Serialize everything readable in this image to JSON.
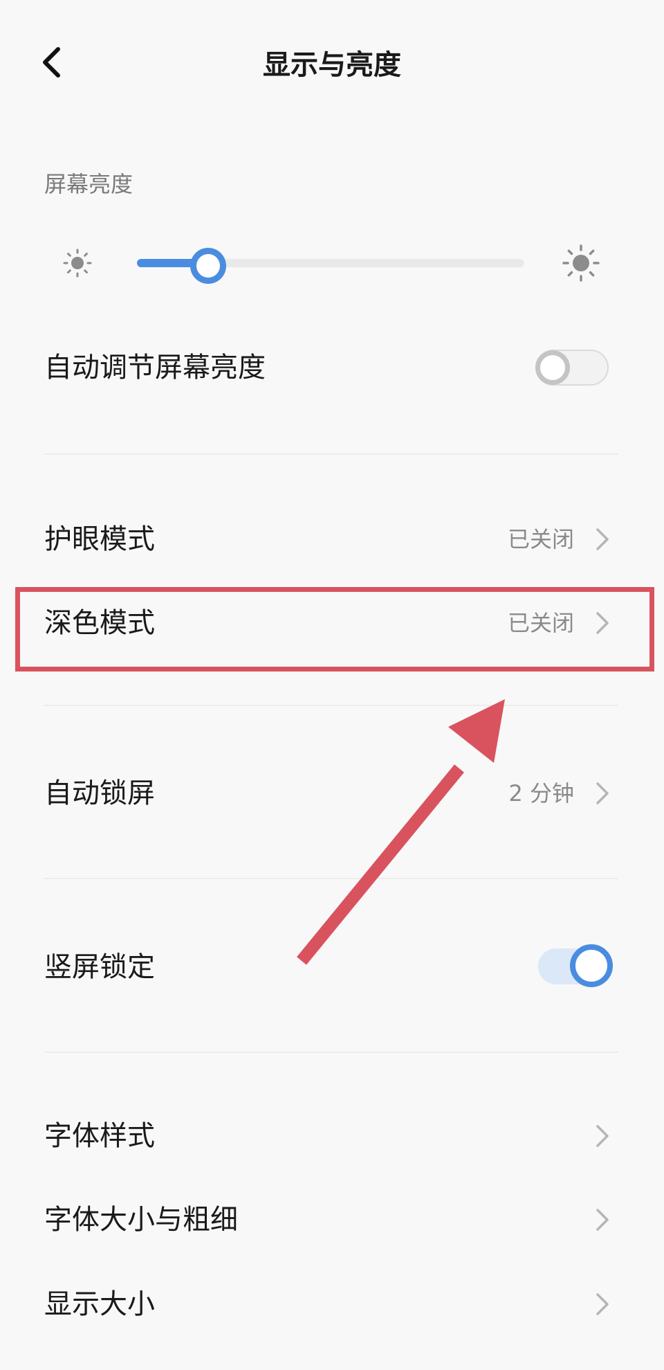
{
  "header": {
    "title": "显示与亮度",
    "back_icon": "chevron-left-icon"
  },
  "brightness": {
    "section_label": "屏幕亮度",
    "level": 0.18,
    "low_icon": "sun-small-icon",
    "high_icon": "sun-large-icon",
    "accent_color": "#4a8de0"
  },
  "rows": {
    "auto_brightness": {
      "label": "自动调节屏幕亮度",
      "toggle_on": false
    },
    "eye_protection": {
      "label": "护眼模式",
      "value": "已关闭"
    },
    "dark_mode": {
      "label": "深色模式",
      "value": "已关闭"
    },
    "auto_lock": {
      "label": "自动锁屏",
      "value": "2 分钟"
    },
    "portrait_lock": {
      "label": "竖屏锁定",
      "toggle_on": true
    },
    "font_style": {
      "label": "字体样式"
    },
    "font_size": {
      "label": "字体大小与粗细"
    },
    "display_size": {
      "label": "显示大小"
    }
  },
  "annotation": {
    "highlight_color": "#d9535f",
    "arrow_color": "#d9535f"
  }
}
